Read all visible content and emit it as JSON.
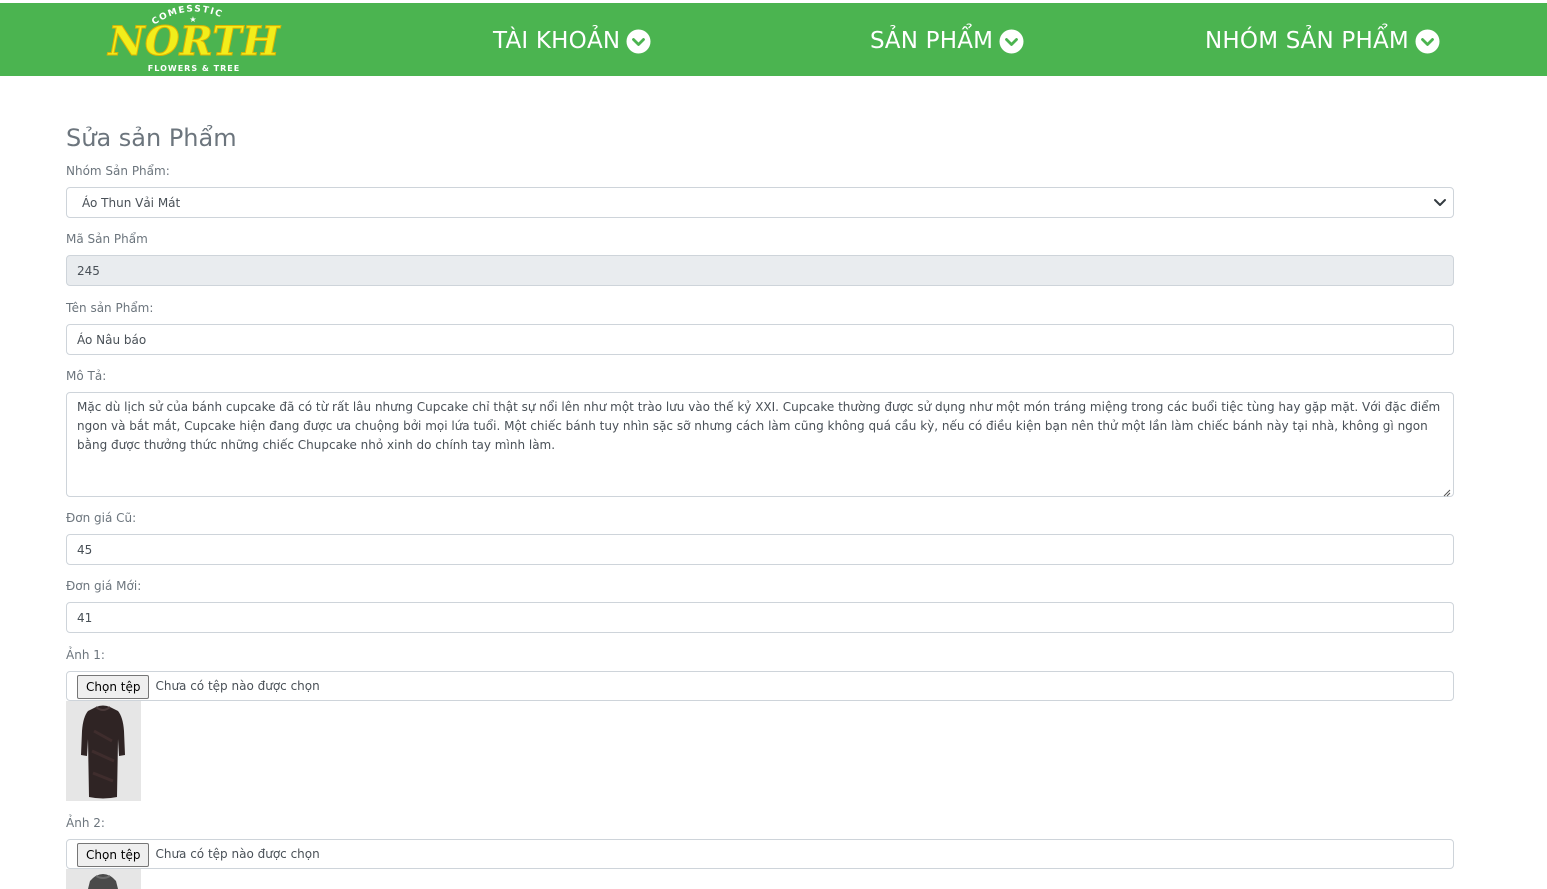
{
  "header": {
    "logo": {
      "arc_text": "COMESSTIC",
      "wordmark": "NORTH",
      "tagline": "FLOWERS & TREE"
    },
    "nav": [
      {
        "label": "TÀI KHOẢN",
        "icon": "chevron-down-circle-icon"
      },
      {
        "label": "SẢN PHẨM",
        "icon": "chevron-down-circle-icon"
      },
      {
        "label": "NHÓM SẢN PHẨM",
        "icon": "chevron-down-circle-icon"
      }
    ],
    "background_color": "#4bb450"
  },
  "form": {
    "title": "Sửa sản Phẩm",
    "group": {
      "label": "Nhóm Sản Phẩm:",
      "value": "Áo Thun Vải Mát"
    },
    "code": {
      "label": "Mã Sản Phẩm",
      "value": "245"
    },
    "name": {
      "label": "Tên sản Phẩm:",
      "value": "Áo Nâu báo"
    },
    "description": {
      "label": "Mô Tả:",
      "value": "Mặc dù lịch sử của bánh cupcake đã có từ rất lâu nhưng  Cupcake chỉ thật sự nổi lên như một trào lưu vào thế kỷ XXI. Cupcake thường được sử dụng như một món tráng miệng trong các buổi tiệc tùng hay gặp mặt. Với đặc điểm ngon và bắt mắt, Cupcake hiện đang được ưa chuộng bởi mọi lứa tuổi. Một chiếc bánh tuy nhìn sặc sỡ nhưng cách làm cũng không quá cầu kỳ, nếu có điều kiện bạn nên thử một lần làm chiếc bánh này tại nhà, không gì ngon bằng được thưởng thức những chiếc Chupcake nhỏ xinh do chính tay mình làm."
    },
    "old_price": {
      "label": "Đơn giá Cũ:",
      "value": "45"
    },
    "new_price": {
      "label": "Đơn giá Mới:",
      "value": "41"
    },
    "image1": {
      "label": "Ảnh 1:",
      "button": "Chọn tệp",
      "status": "Chưa có tệp nào được chọn"
    },
    "image2": {
      "label": "Ảnh 2:",
      "button": "Chọn tệp",
      "status": "Chưa có tệp nào được chọn"
    }
  }
}
